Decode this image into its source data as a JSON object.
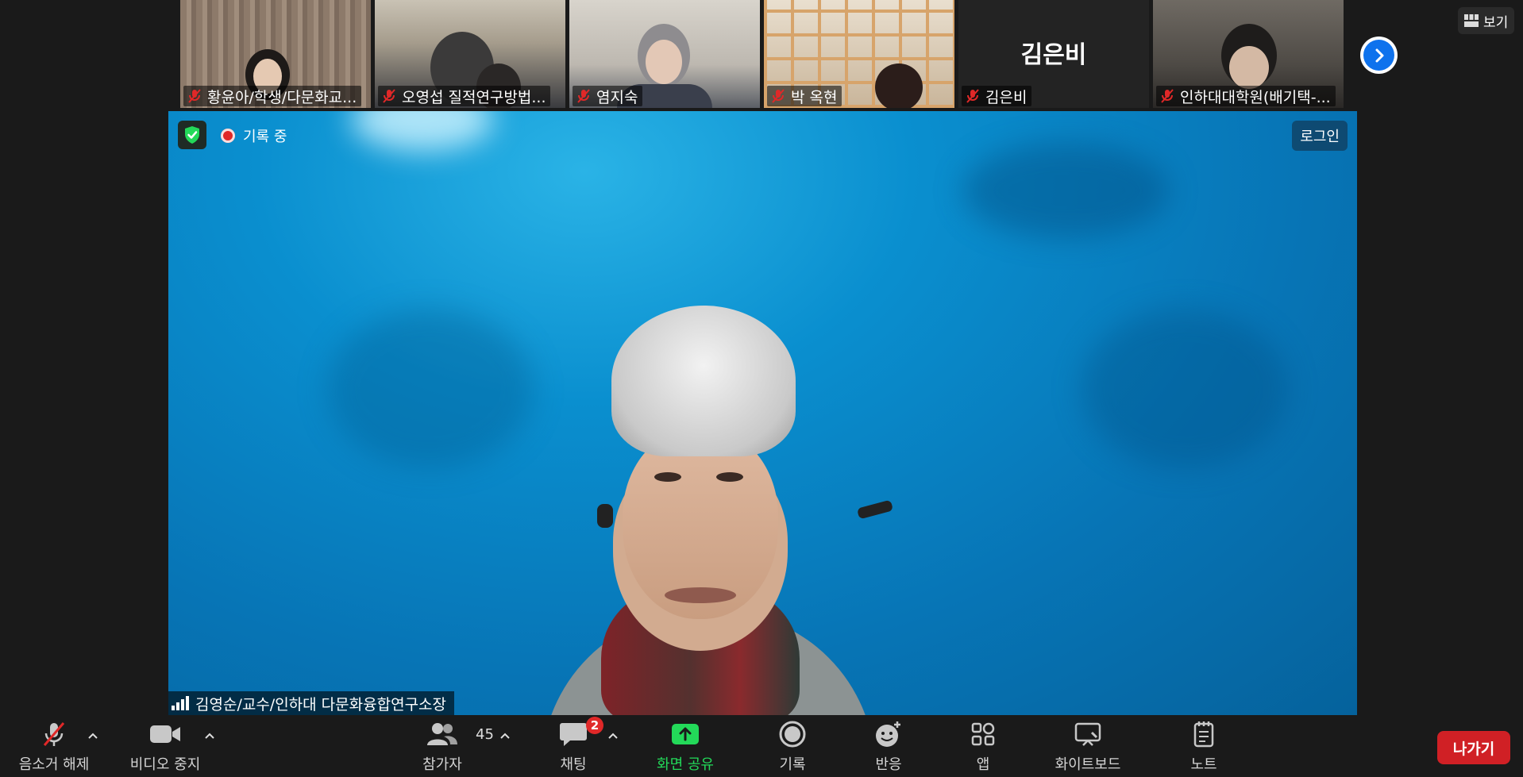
{
  "gallery": {
    "thumbnails": [
      {
        "name": "황윤아/학생/다문화교...",
        "muted": true
      },
      {
        "name": "오영섭 질적연구방법...",
        "muted": true
      },
      {
        "name": "염지숙",
        "muted": true
      },
      {
        "name": "박 옥현",
        "muted": true
      },
      {
        "name": "김은비",
        "muted": true,
        "video_off_name": "김은비"
      },
      {
        "name": "인하대대학원(배기택-...",
        "muted": true
      }
    ],
    "next_page_icon": "chevron-right-icon"
  },
  "view_menu": {
    "label": "보기",
    "icon": "grid-icon"
  },
  "main_video": {
    "recording_label": "기록 중",
    "login_label": "로그인",
    "speaker_name": "김영순/교수/인하대 다문화융합연구소장",
    "security_icon": "shield-check-icon",
    "signal_icon": "signal-bars-icon"
  },
  "toolbar": {
    "unmute_label": "음소거 해제",
    "video_label": "비디오 중지",
    "participants_label": "참가자",
    "participants_count": "45",
    "chat_label": "채팅",
    "chat_badge": "2",
    "share_label": "화면 공유",
    "record_label": "기록",
    "reactions_label": "반응",
    "apps_label": "앱",
    "whiteboard_label": "화이트보드",
    "notes_label": "노트",
    "leave_label": "나가기"
  },
  "colors": {
    "accent_blue": "#0e72ed",
    "share_green": "#23d959",
    "leave_red": "#d02025",
    "muted_red": "#e02828"
  }
}
